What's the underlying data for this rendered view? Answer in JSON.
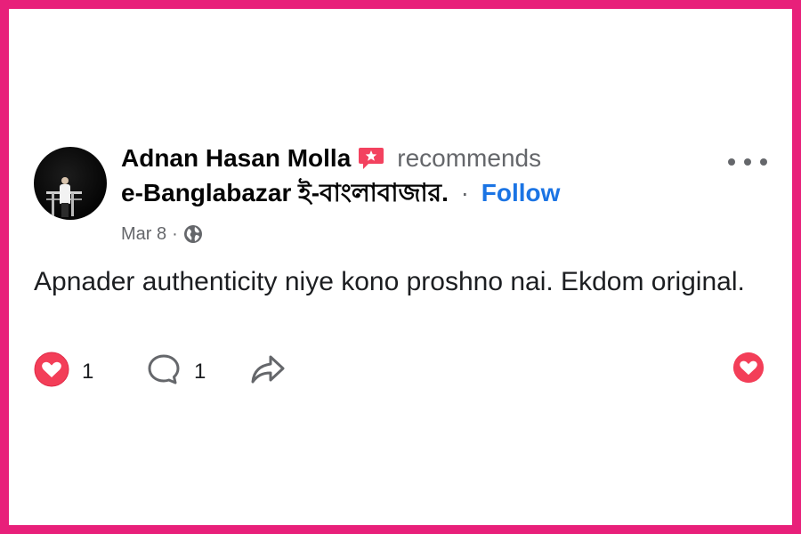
{
  "post": {
    "author": "Adnan Hasan Molla",
    "verb": "recommends",
    "page_name": "e-Banglabazar ই-বাংলাবাজার.",
    "separator": "·",
    "follow_label": "Follow",
    "date": "Mar 8",
    "meta_separator": "·",
    "privacy_icon": "globe-icon",
    "text": "Apnader authenticity niye kono proshno nai. Ekdom original."
  },
  "actions": {
    "love_count": "1",
    "comment_count": "1",
    "love_icon": "heart-icon",
    "comment_icon": "comment-bubble-icon",
    "share_icon": "share-arrow-icon",
    "more_icon": "more-dots-icon"
  },
  "colors": {
    "frame": "#e8207a",
    "follow": "#1b74e4",
    "love": "#f33e58",
    "badge": "#f3425f",
    "muted": "#65676b"
  }
}
